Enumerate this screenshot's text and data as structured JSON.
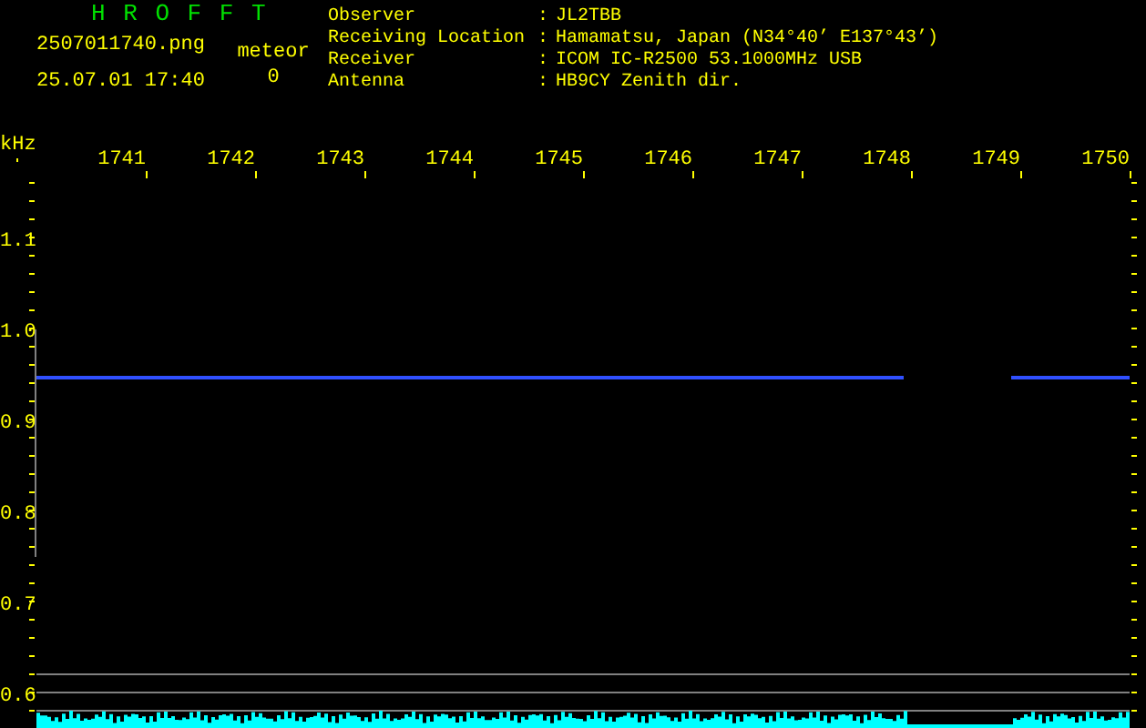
{
  "header": {
    "title": "H R O F F T",
    "filename": "2507011740.png",
    "datetime": "25.07.01 17:40",
    "counter_label": "meteor",
    "counter_value": "0"
  },
  "station": [
    {
      "label": "Observer",
      "separator": ":",
      "value": "JL2TBB"
    },
    {
      "label": "Receiving Location",
      "separator": ":",
      "value": "Hamamatsu, Japan (N34°40’ E137°43’)"
    },
    {
      "label": "Receiver",
      "separator": ":",
      "value": "ICOM IC-R2500 53.1000MHz USB"
    },
    {
      "label": "Antenna",
      "separator": ":",
      "value": "HB9CY Zenith dir."
    }
  ],
  "plot": {
    "y_unit": "kHz",
    "x_ticks": [
      "1741",
      "1742",
      "1743",
      "1744",
      "1745",
      "1746",
      "1747",
      "1748",
      "1749",
      "1750"
    ],
    "y_ticks": [
      "1.1",
      "1.0",
      "0.9",
      "0.8",
      "0.7",
      "0.6"
    ]
  }
}
